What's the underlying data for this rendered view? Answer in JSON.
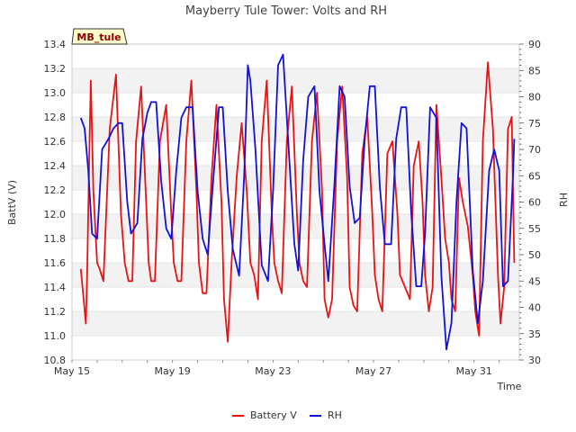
{
  "chart_data": {
    "type": "line",
    "title": "Mayberry Tule Tower: Volts and RH",
    "site_label": "MB_tule",
    "xlabel": "Time",
    "ylabel_left": "BattV (V)",
    "ylabel_right": "RH",
    "x_ticks": [
      {
        "day": 15,
        "label": "May 15"
      },
      {
        "day": 19,
        "label": "May 19"
      },
      {
        "day": 23,
        "label": "May 23"
      },
      {
        "day": 27,
        "label": "May 27"
      },
      {
        "day": 31,
        "label": "May 31"
      }
    ],
    "xlim_day": [
      15,
      32.8
    ],
    "ylim_left": [
      10.8,
      13.4
    ],
    "y_ticks_left": [
      "10.8",
      "11.0",
      "11.2",
      "11.4",
      "11.6",
      "11.8",
      "12.0",
      "12.2",
      "12.4",
      "12.6",
      "12.8",
      "13.0",
      "13.2",
      "13.4"
    ],
    "ylim_right": [
      30,
      90
    ],
    "y_ticks_right": [
      "30",
      "35",
      "40",
      "45",
      "50",
      "55",
      "60",
      "65",
      "70",
      "75",
      "80",
      "85",
      "90"
    ],
    "grid": "horizontal alternating bands",
    "legend_position": "bottom-center",
    "series": [
      {
        "name": "Battery V",
        "axis": "left",
        "color": "#ee1111",
        "x_day": [
          15.35,
          15.55,
          15.6,
          15.7,
          15.75,
          15.85,
          16.0,
          16.1,
          16.25,
          16.5,
          16.75,
          16.95,
          17.1,
          17.25,
          17.4,
          17.55,
          17.75,
          17.95,
          18.05,
          18.15,
          18.3,
          18.5,
          18.75,
          18.95,
          19.05,
          19.2,
          19.35,
          19.55,
          19.75,
          19.95,
          20.05,
          20.2,
          20.35,
          20.55,
          20.75,
          20.95,
          21.05,
          21.2,
          21.35,
          21.55,
          21.75,
          21.95,
          22.1,
          22.25,
          22.4,
          22.55,
          22.75,
          22.95,
          23.05,
          23.2,
          23.35,
          23.55,
          23.75,
          23.95,
          24.05,
          24.2,
          24.35,
          24.55,
          24.75,
          24.95,
          25.05,
          25.2,
          25.35,
          25.55,
          25.75,
          25.95,
          26.05,
          26.2,
          26.35,
          26.55,
          26.75,
          26.95,
          27.05,
          27.2,
          27.35,
          27.55,
          27.75,
          27.95,
          28.05,
          28.25,
          28.45,
          28.6,
          28.8,
          28.95,
          29.05,
          29.2,
          29.35,
          29.5,
          29.7,
          29.85,
          30.0,
          30.1,
          30.25,
          30.4,
          30.55,
          30.75,
          30.95,
          31.05,
          31.2,
          31.35,
          31.55,
          31.75,
          31.95,
          32.05,
          32.2,
          32.35,
          32.5,
          32.6
        ],
        "y": [
          11.55,
          11.1,
          11.5,
          12.6,
          13.1,
          12.2,
          11.6,
          11.55,
          11.45,
          12.7,
          13.15,
          12.0,
          11.6,
          11.45,
          11.45,
          12.6,
          13.05,
          12.1,
          11.6,
          11.45,
          11.45,
          12.6,
          12.9,
          12.0,
          11.6,
          11.45,
          11.45,
          12.6,
          13.1,
          12.2,
          11.6,
          11.35,
          11.35,
          12.3,
          12.9,
          12.1,
          11.3,
          10.95,
          11.6,
          12.3,
          12.75,
          12.2,
          11.6,
          11.5,
          11.3,
          12.6,
          13.1,
          12.0,
          11.6,
          11.45,
          11.35,
          12.6,
          13.05,
          12.0,
          11.6,
          11.45,
          11.4,
          12.6,
          13.0,
          12.2,
          11.3,
          11.15,
          11.3,
          12.6,
          13.05,
          12.3,
          11.4,
          11.25,
          11.2,
          12.5,
          12.8,
          12.0,
          11.5,
          11.3,
          11.2,
          12.5,
          12.6,
          12.0,
          11.5,
          11.4,
          11.3,
          12.4,
          12.6,
          12.1,
          11.5,
          11.2,
          11.4,
          12.9,
          12.3,
          11.8,
          11.6,
          11.3,
          11.2,
          12.3,
          12.1,
          11.9,
          11.5,
          11.2,
          11.0,
          12.6,
          13.25,
          12.7,
          11.5,
          11.1,
          11.4,
          12.7,
          12.8,
          11.6
        ]
      },
      {
        "name": "RH",
        "axis": "right",
        "color": "#1111dd",
        "x_day": [
          15.35,
          15.5,
          15.65,
          15.8,
          16.0,
          16.2,
          16.45,
          16.65,
          16.85,
          17.0,
          17.2,
          17.35,
          17.6,
          17.8,
          18.0,
          18.15,
          18.35,
          18.55,
          18.75,
          18.95,
          19.15,
          19.35,
          19.55,
          19.8,
          20.0,
          20.2,
          20.4,
          20.6,
          20.85,
          21.0,
          21.2,
          21.4,
          21.65,
          21.85,
          22.0,
          22.1,
          22.3,
          22.55,
          22.8,
          23.0,
          23.2,
          23.4,
          23.6,
          23.85,
          24.0,
          24.2,
          24.4,
          24.65,
          24.85,
          25.05,
          25.2,
          25.45,
          25.65,
          25.85,
          26.05,
          26.25,
          26.45,
          26.65,
          26.85,
          27.05,
          27.25,
          27.45,
          27.7,
          27.9,
          28.1,
          28.3,
          28.5,
          28.7,
          28.9,
          29.05,
          29.25,
          29.5,
          29.7,
          29.9,
          30.1,
          30.3,
          30.5,
          30.7,
          30.95,
          31.15,
          31.35,
          31.6,
          31.8,
          32.0,
          32.15,
          32.35,
          32.55,
          32.6
        ],
        "y": [
          76,
          74,
          66,
          54,
          53,
          70,
          72,
          74,
          75,
          75,
          60,
          54,
          56,
          72,
          77,
          79,
          79,
          64,
          55,
          53,
          66,
          76,
          78,
          78,
          62,
          53,
          50,
          63,
          78,
          78,
          62,
          51,
          46,
          65,
          86,
          83,
          70,
          48,
          45,
          62,
          86,
          88,
          72,
          52,
          47,
          68,
          80,
          82,
          62,
          52,
          45,
          64,
          82,
          80,
          63,
          56,
          57,
          72,
          82,
          82,
          63,
          52,
          52,
          72,
          78,
          78,
          58,
          44,
          44,
          54,
          78,
          76,
          46,
          32,
          37,
          60,
          75,
          74,
          47,
          37,
          45,
          66,
          70,
          66,
          44,
          45,
          65,
          72
        ]
      }
    ]
  },
  "legend": {
    "items": [
      {
        "label": "Battery V",
        "color": "#ee1111"
      },
      {
        "label": "RH",
        "color": "#1111dd"
      }
    ]
  }
}
